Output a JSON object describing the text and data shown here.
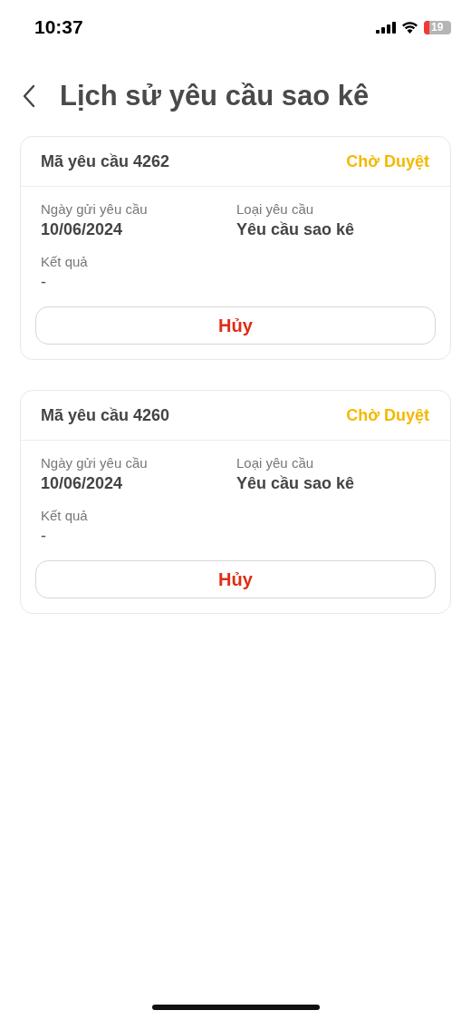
{
  "status_bar": {
    "time": "10:37",
    "battery": "19"
  },
  "header": {
    "title": "Lịch sử yêu cầu sao kê"
  },
  "requests": [
    {
      "code": "Mã yêu cầu 4262",
      "status": "Chờ Duyệt",
      "color": "#f5b800",
      "date_label": "Ngày gửi yêu cầu",
      "date": "10/06/2024",
      "type_label": "Loại yêu cầu",
      "type": "Yêu cầu sao kê",
      "result_label": "Kết quả",
      "result": "-",
      "action": "Hủy"
    },
    {
      "code": "Mã yêu cầu 4260",
      "status": "Chờ Duyệt",
      "color": "#f5b800",
      "date_label": "Ngày gửi yêu cầu",
      "date": "10/06/2024",
      "type_label": "Loại yêu cầu",
      "type": "Yêu cầu sao kê",
      "result_label": "Kết quả",
      "result": "-",
      "action": "Hủy"
    }
  ]
}
